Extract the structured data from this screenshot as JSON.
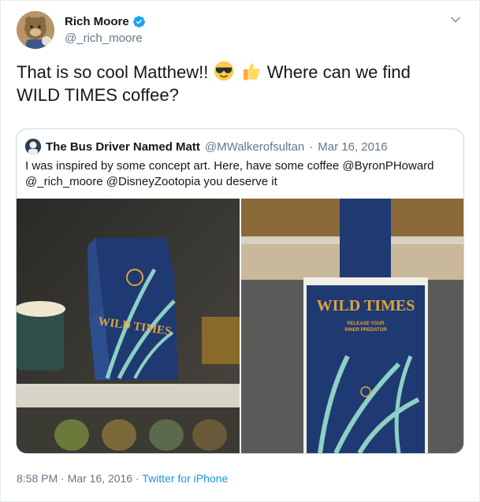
{
  "author": {
    "display_name": "Rich Moore",
    "handle": "@_rich_moore",
    "verified": true
  },
  "tweet": {
    "line1_before": "That is so cool Matthew!!",
    "emojis": [
      "sunglasses-emoji",
      "thumbs-up-emoji"
    ],
    "line1_after": "Where can we find",
    "line2": "WILD TIMES coffee?"
  },
  "quoted": {
    "display_name": "The Bus Driver Named Matt",
    "handle": "@MWalkerofsultan",
    "separator": "·",
    "date": "Mar 16, 2016",
    "text_line1": "I was inspired by some concept art. Here, have some coffee @ByronPHoward",
    "text_line2": "@_rich_moore @DisneyZootopia you deserve it",
    "photos": [
      {
        "subject": "wild-times-coffee-bag-photo",
        "bag_label": "WILD TIMES"
      },
      {
        "subject": "wild-times-sign-photo",
        "sign_title": "WILD TIMES",
        "sign_subtitle_1": "RELEASE YOUR",
        "sign_subtitle_2": "INNER PREDATOR"
      }
    ]
  },
  "footer": {
    "time": "8:58 PM",
    "separator": "·",
    "date": "Mar 16, 2016",
    "source": "Twitter for iPhone"
  },
  "colors": {
    "link": "#1b95e0",
    "verified": "#1da1f2",
    "muted": "#657786",
    "border": "#ccd6dd",
    "package_blue": "#1f3a73",
    "package_gold": "#e0a23a",
    "package_green": "#8fd0c4"
  }
}
